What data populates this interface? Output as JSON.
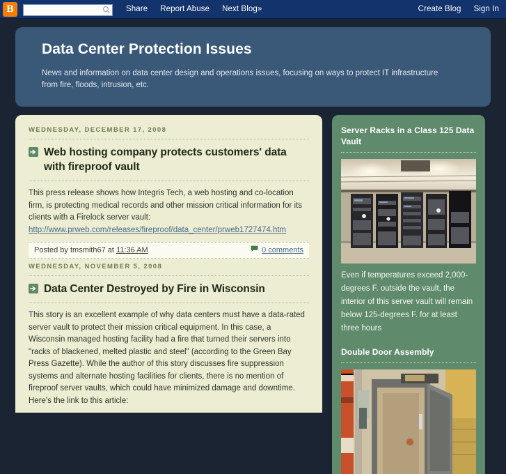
{
  "navbar": {
    "logo_letter": "B",
    "search_placeholder": "",
    "search_value": "",
    "search_icon": "search-icon",
    "links": [
      {
        "label": "Share"
      },
      {
        "label": "Report Abuse"
      },
      {
        "label": "Next Blog»"
      }
    ],
    "right_links": [
      {
        "label": "Create Blog"
      },
      {
        "label": "Sign In"
      }
    ]
  },
  "header": {
    "title": "Data Center Protection Issues",
    "description": "News and information on data center design and operations issues, focusing on ways to protect IT infrastructure from fire, floods, intrusion, etc."
  },
  "posts": [
    {
      "date": "WEDNESDAY, DECEMBER 17, 2008",
      "title": "Web hosting company protects customers' data with fireproof vault",
      "body": "This press release shows how Integris Tech, a web hosting and co-location firm, is protecting medical records and other mission critical information for its clients with a Firelock server vault:",
      "link": "http://www.prweb.com/releases/fireproof/data_center/prweb1727474.htm",
      "footer_prefix": "Posted by tmsmith67 at",
      "timestamp": "11:36 AM",
      "comments_label": "0 comments"
    },
    {
      "date": "WEDNESDAY, NOVEMBER 5, 2008",
      "title": "Data Center Destroyed by Fire in Wisconsin",
      "body": "This story is an excellent example of why data centers must have a data-rated server vault to protect their mission critical equipment. In this case, a Wisconsin managed hosting facility had a fire that turned their servers into \"racks of blackened, melted plastic and steel\" (according to the Green Bay Press Gazette). While the author of this story discusses fire suppression systems and alternate hosting facilities for clients, there is no mention of fireproof server vaults, which could have minimized damage and downtime. Here's the link to this article:"
    }
  ],
  "sidebar": {
    "widgets": [
      {
        "title": "Server Racks in a Class 125 Data Vault",
        "image_alt": "server-racks-photo",
        "caption": "Even if temperatures exceed 2,000-degrees F. outside the vault, the interior of this server vault will remain below 125-degrees F. for at least three hours"
      },
      {
        "title": "Double Door Assembly",
        "image_alt": "double-door-assembly-photo",
        "caption": ""
      }
    ]
  },
  "colors": {
    "page_background": "#1b2433",
    "navbar": "#12336b",
    "brand_orange": "#f57d00",
    "header_banner": "#3a5878",
    "main_panel": "#ecedd2",
    "sidebar_panel": "#5f8a6b",
    "link": "#4c6b86",
    "date_text": "#6f7d55"
  }
}
